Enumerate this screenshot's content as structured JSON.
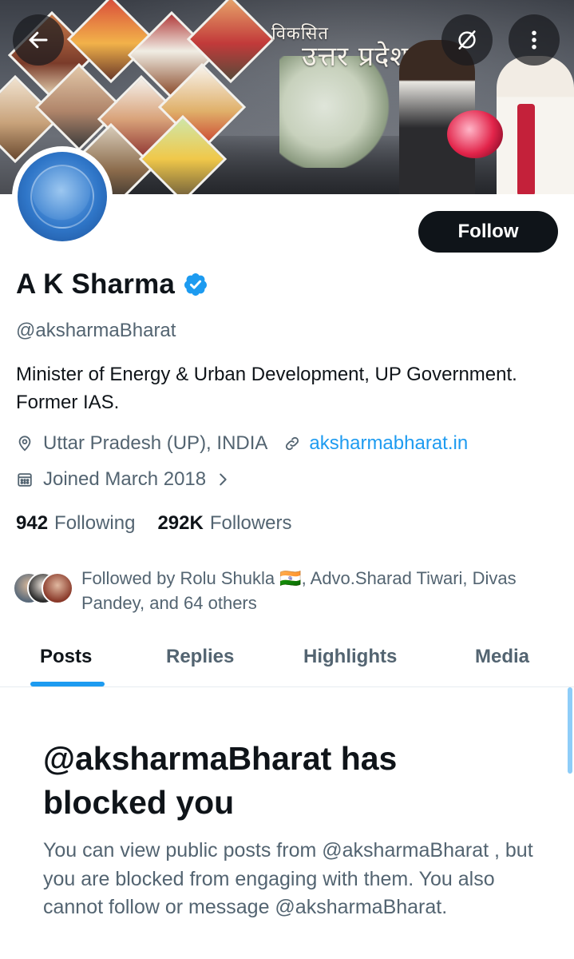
{
  "banner": {
    "title_line1": "विकसित",
    "title_line2": "उत्तर प्रदेश"
  },
  "header": {
    "back_label": "Back",
    "grok_label": "Grok",
    "more_label": "More"
  },
  "profile": {
    "name": "A K Sharma",
    "handle": "@aksharmaBharat",
    "bio": "Minister of Energy & Urban Development, UP Government. Former IAS.",
    "location": "Uttar Pradesh (UP), INDIA",
    "website": "aksharmabharat.in",
    "joined": "Joined March 2018",
    "following_count": "942",
    "following_label": "Following",
    "followers_count": "292K",
    "followers_label": "Followers",
    "followed_by": "Followed by Rolu Shukla 🇮🇳, Advo.Sharad Tiwari, Divas Pandey, and 64 others"
  },
  "actions": {
    "follow_label": "Follow"
  },
  "tabs": [
    {
      "label": "Posts",
      "active": true
    },
    {
      "label": "Replies",
      "active": false
    },
    {
      "label": "Highlights",
      "active": false
    },
    {
      "label": "Media",
      "active": false
    }
  ],
  "blocked": {
    "title": "@aksharmaBharat has blocked you",
    "body": "You can view public posts from @aksharmaBharat , but you are blocked from engaging with them. You also cannot follow or message @aksharmaBharat."
  },
  "colors": {
    "accent": "#1d9bf0",
    "text": "#0f1419",
    "secondary": "#536471"
  },
  "icons": [
    "back-arrow-icon",
    "grok-icon",
    "more-vertical-icon",
    "verified-badge-icon",
    "location-pin-icon",
    "link-icon",
    "calendar-icon",
    "chevron-right-icon"
  ]
}
